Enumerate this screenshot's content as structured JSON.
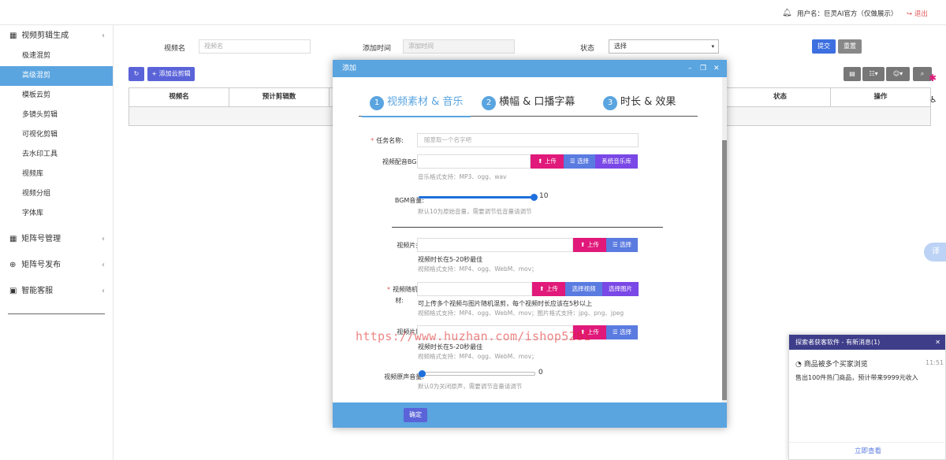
{
  "topbar": {
    "user": "用户名：巨灵AI官方（仅做展示）",
    "logout": "退出"
  },
  "sidebar": {
    "group1": {
      "label": "视频剪辑生成",
      "icon": "film-icon"
    },
    "items": [
      {
        "label": "极速混剪"
      },
      {
        "label": "高级混剪",
        "active": true
      },
      {
        "label": "模板云剪"
      },
      {
        "label": "多镜头剪辑"
      },
      {
        "label": "可视化剪辑"
      },
      {
        "label": "去水印工具"
      },
      {
        "label": "视频库"
      },
      {
        "label": "视频分组"
      },
      {
        "label": "字体库"
      }
    ],
    "group2": {
      "label": "矩阵号管理",
      "icon": "grid-icon"
    },
    "group3": {
      "label": "矩阵号发布",
      "icon": "plus-circle-icon"
    },
    "group4": {
      "label": "智能客服",
      "icon": "chat-icon"
    }
  },
  "filters": {
    "name_label": "视频名",
    "name_placeholder": "视频名",
    "time_label": "添加时间",
    "time_placeholder": "添加时间",
    "status_label": "状态",
    "status_value": "选择",
    "submit": "提交",
    "reset": "重置"
  },
  "toolbar": {
    "add_label": "添加云剪辑"
  },
  "table": {
    "headers": [
      "视频名",
      "预计剪辑数",
      "状态",
      "操作"
    ]
  },
  "modal": {
    "title": "添加",
    "steps": [
      {
        "num": "1",
        "label": "视频素材 & 音乐"
      },
      {
        "num": "2",
        "label": "横幅 & 口播字幕"
      },
      {
        "num": "3",
        "label": "时长 & 效果"
      }
    ],
    "task_name_label": "任务名称:",
    "task_name_placeholder": "随意取一个名字吧",
    "bgm_label": "视频配音BGM:",
    "upload": "上传",
    "select": "选择",
    "system_music": "系统音乐库",
    "bgm_hint": "音乐格式支持：MP3、ogg、wav",
    "bgm_volume_label": "BGM音量:",
    "bgm_volume": 10,
    "bgm_volume_hint": "默认10为原始音量，需要调节低音量请调节",
    "head_label": "视频片头:",
    "head_note": "视频时长在5-20秒最佳",
    "video_format_hint": "视频格式支持：MP4、ogg、WebM、mov；",
    "random_label_1": "视频随机素",
    "random_label_2": "材:",
    "select_video": "选择视频",
    "select_image": "选择图片",
    "random_note": "可上传多个视频与图片随机混剪，每个视频时长应该在5秒以上",
    "random_hint": "视频格式支持：MP4、ogg、WebM、mov；图片格式支持：jpg、png、jpeg",
    "tail_label": "视频片尾:",
    "tail_note": "视频时长在5-20秒最佳",
    "orig_volume_label": "视频原声音量:",
    "orig_volume": 0,
    "orig_volume_hint": "默认0为关闭原声，需要调节音量请调节",
    "confirm": "确定"
  },
  "watermark": "https://www.huzhan.com/ishop5281",
  "notification": {
    "title": "探索者获客软件 - 有新消息(1)",
    "headline": "商品被多个买家浏览",
    "time": "11:51",
    "body": "售出100件热门商品，预计带来9999元收入",
    "link": "立即查看"
  },
  "side_fab": "译"
}
